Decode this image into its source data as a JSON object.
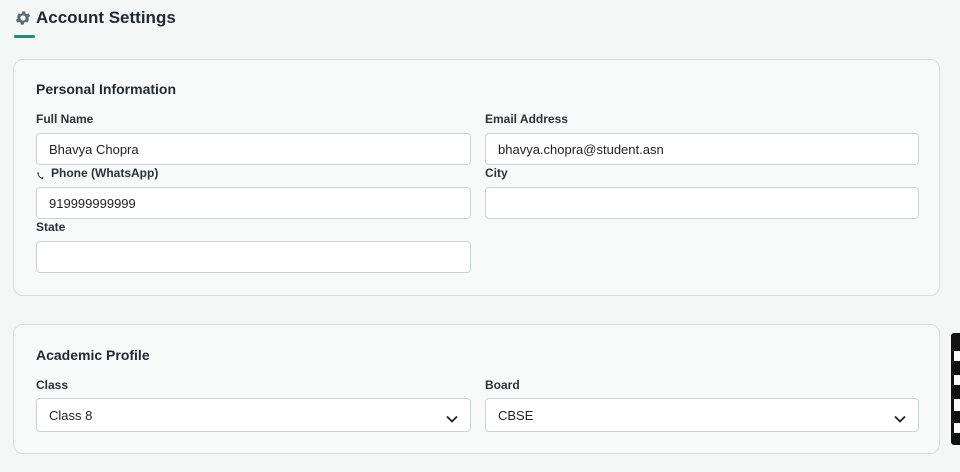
{
  "header": {
    "title": "Account Settings",
    "icon": "gear-icon"
  },
  "personal": {
    "title": "Personal Information",
    "full_name": {
      "label": "Full Name",
      "value": "Bhavya Chopra"
    },
    "email": {
      "label": "Email Address",
      "value": "bhavya.chopra@student.asn"
    },
    "phone": {
      "label": "Phone (WhatsApp)",
      "value": "919999999999",
      "icon": "phone-icon"
    },
    "city": {
      "label": "City",
      "value": ""
    },
    "state": {
      "label": "State",
      "value": ""
    }
  },
  "academic": {
    "title": "Academic Profile",
    "class": {
      "label": "Class",
      "value": "Class 8"
    },
    "board": {
      "label": "Board",
      "value": "CBSE"
    }
  },
  "colors": {
    "accent": "#1f8f7a",
    "card_border": "#d6dedb",
    "page_bg": "#f3f7f6"
  }
}
